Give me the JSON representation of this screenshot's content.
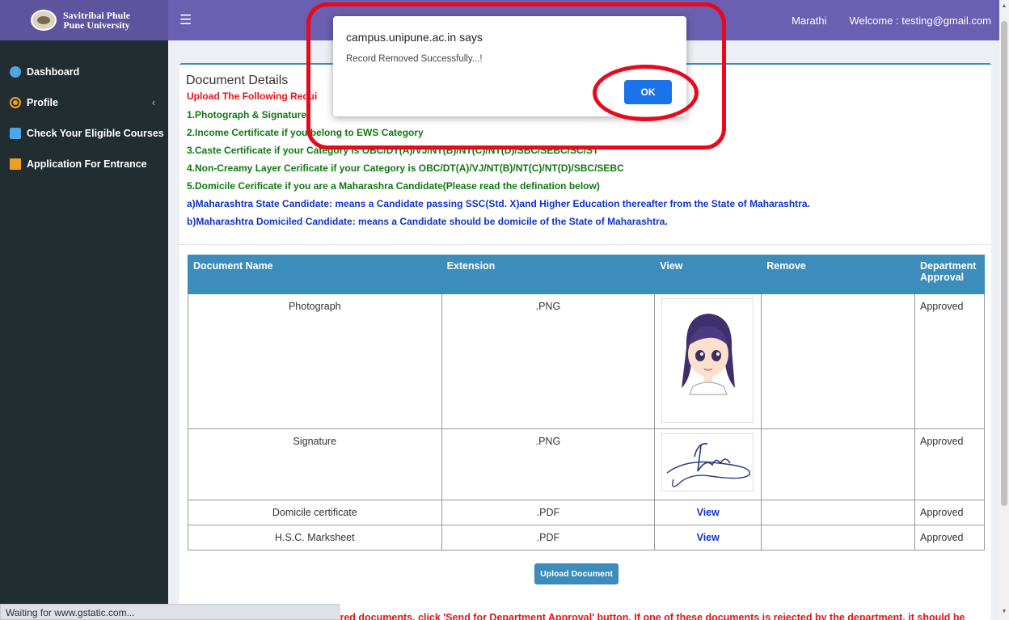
{
  "header": {
    "logo_line1": "Savitribai Phule",
    "logo_line2": "Pune University",
    "menu_icon": "hamburger-icon",
    "language": "Marathi",
    "welcome": "Welcome : testing@gmail.com"
  },
  "sidebar": {
    "items": [
      {
        "label": "Dashboard",
        "icon": "dashboard-icon"
      },
      {
        "label": "Profile",
        "icon": "user-circle-icon"
      },
      {
        "label": "Check Your Eligible Courses",
        "icon": "edit-icon"
      },
      {
        "label": "Application For Entrance",
        "icon": "book-icon"
      }
    ]
  },
  "status_bar": "Waiting for www.gstatic.com...",
  "main": {
    "title": "Document Details",
    "instructions": [
      "Upload The Following Requi",
      "1.Photograph & Signature",
      "2.Income Certificate if you belong to EWS Category",
      "3.Caste Certificate if your Category is OBC/DT(A)/VJ/NT(B)/NT(C)/NT(D)/SBC/SEBC/SC/ST",
      "4.Non-Creamy Layer Cerificate if your Category is OBC/DT(A)/VJ/NT(B)/NT(C)/NT(D)/SBC/SEBC",
      "5.Domicile Cerificate if you are a Maharashra Candidate(Please read the defination below)",
      "a)Maharashtra State Candidate: means a Candidate passing SSC(Std. X)and Higher Education thereafter from the State of Maharashtra.",
      "b)Maharashtra Domiciled Candidate: means a Candidate should be domicile of the State of Maharashtra."
    ],
    "table": {
      "headers": [
        "Document Name",
        "Extension",
        "View",
        "Remove",
        "Department Approval"
      ],
      "rows": [
        {
          "name": "Photograph",
          "ext": ".PNG",
          "view": "",
          "remove": "",
          "status": "Approved"
        },
        {
          "name": "Signature",
          "ext": ".PNG",
          "view": "",
          "remove": "",
          "status": "Approved"
        },
        {
          "name": "Domicile certificate",
          "ext": ".PDF",
          "view": "View",
          "remove": "",
          "status": "Approved"
        },
        {
          "name": "H.S.C. Marksheet",
          "ext": ".PDF",
          "view": "View",
          "remove": "",
          "status": "Approved"
        }
      ]
    },
    "upload_button": "Upload Document",
    "bottom_note": "ired documents, click 'Send for Department Approval' button. If one of these documents is rejected by the department, it should be"
  },
  "dialog": {
    "title": "campus.unipune.ac.in says",
    "message": "Record Removed Successfully...!",
    "ok_label": "OK"
  },
  "colors": {
    "header": "#6a5fb0",
    "sidebar": "#222d32",
    "table_header": "#3c8dbc",
    "approved": "#ee5533",
    "annotation": "#e8091c"
  }
}
